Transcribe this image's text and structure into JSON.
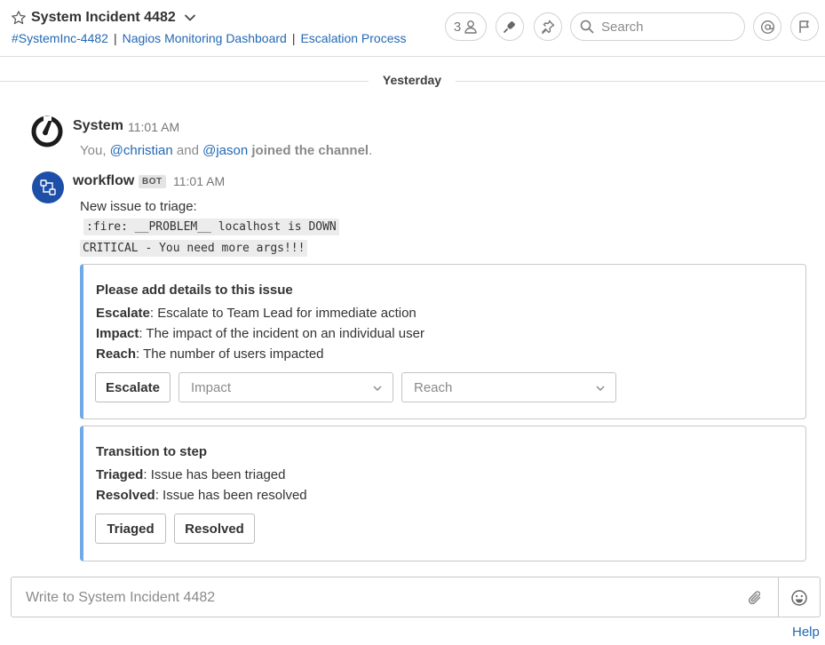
{
  "header": {
    "title": "System Incident 4482",
    "links": [
      "#SystemInc-4482",
      "Nagios Monitoring Dashboard",
      "Escalation Process"
    ],
    "separator": "|",
    "member_count": "3",
    "search_placeholder": "Search"
  },
  "date_separator": "Yesterday",
  "posts": {
    "system": {
      "author": "System",
      "time": "11:01 AM",
      "msg_prefix": "You,",
      "mention1": "@christian",
      "and": "and",
      "mention2": "@jason",
      "joined": "joined the channel",
      "period": "."
    },
    "workflow": {
      "author": "workflow",
      "badge": "BOT",
      "time": "11:01 AM",
      "intro": "New issue to triage:",
      "code1": ":fire: __PROBLEM__ localhost is DOWN",
      "code2": "CRITICAL - You need more args!!!"
    }
  },
  "attachment1": {
    "title": "Please add details to this issue",
    "fields": [
      {
        "name": "Escalate",
        "text": ": Escalate to Team Lead for immediate action"
      },
      {
        "name": "Impact",
        "text": ": The impact of the incident on an individual user"
      },
      {
        "name": "Reach",
        "text": ": The number of users impacted"
      }
    ],
    "button": "Escalate",
    "select_impact": "Impact",
    "select_reach": "Reach"
  },
  "attachment2": {
    "title": "Transition to step",
    "fields": [
      {
        "name": "Triaged",
        "text": ": Issue has been triaged"
      },
      {
        "name": "Resolved",
        "text": ": Issue has been resolved"
      }
    ],
    "buttons": [
      "Triaged",
      "Resolved"
    ]
  },
  "composer": {
    "placeholder": "Write to System Incident 4482"
  },
  "help_label": "Help",
  "colors": {
    "link": "#2368b4",
    "attachment_bar": "#6fa9e8",
    "workflow_avatar": "#1e4fa8"
  }
}
